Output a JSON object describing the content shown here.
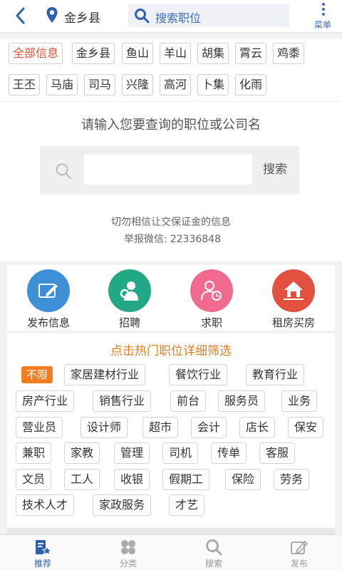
{
  "header": {
    "city": "金乡县",
    "search_placeholder": "搜索职位",
    "menu_label": "菜单"
  },
  "areas": {
    "items": [
      "全部信息",
      "金乡县",
      "鱼山",
      "羊山",
      "胡集",
      "霄云",
      "鸡黍",
      "王丕",
      "马庙",
      "司马",
      "兴隆",
      "高河",
      "卜集",
      "化雨"
    ],
    "active_index": 0
  },
  "search_panel": {
    "prompt": "请输入您要查询的职位或公司名",
    "button_label": "搜索",
    "warning": "切勿相信让交保证金的信息",
    "wechat_label": "举报微信:",
    "wechat_id": "22336848"
  },
  "main_nav": [
    {
      "label": "发布信息",
      "icon": "edit-icon",
      "color": "#3d8fd6"
    },
    {
      "label": "招聘",
      "icon": "recruit-icon",
      "color": "#22a884"
    },
    {
      "label": "求职",
      "icon": "job-seeker-icon",
      "color": "#f06b8f"
    },
    {
      "label": "租房买房",
      "icon": "house-icon",
      "color": "#e2503f"
    }
  ],
  "jobs": {
    "title": "点击热门职位详细筛选",
    "tags": [
      "不限",
      "家居建材行业",
      "餐饮行业",
      "教育行业",
      "房产行业",
      "销售行业",
      "前台",
      "服务员",
      "业务",
      "营业员",
      "设计师",
      "超市",
      "会计",
      "店长",
      "保安",
      "兼职",
      "家教",
      "管理",
      "司机",
      "传单",
      "客服",
      "文员",
      "工人",
      "收银",
      "假期工",
      "保险",
      "劳务",
      "技术人才",
      "家政服务",
      "才艺"
    ],
    "active_index": 0
  },
  "tabbar": [
    {
      "label": "推荐",
      "icon": "recommend-icon",
      "active": true
    },
    {
      "label": "分类",
      "icon": "category-icon",
      "active": false
    },
    {
      "label": "搜索",
      "icon": "search-icon",
      "active": false
    },
    {
      "label": "发布",
      "icon": "publish-icon",
      "active": false
    }
  ],
  "colors": {
    "accent_blue": "#3a6fb5",
    "active_orange": "#f57c1f",
    "active_red_text": "#e8533a",
    "jobs_title_orange": "#e67e22"
  }
}
